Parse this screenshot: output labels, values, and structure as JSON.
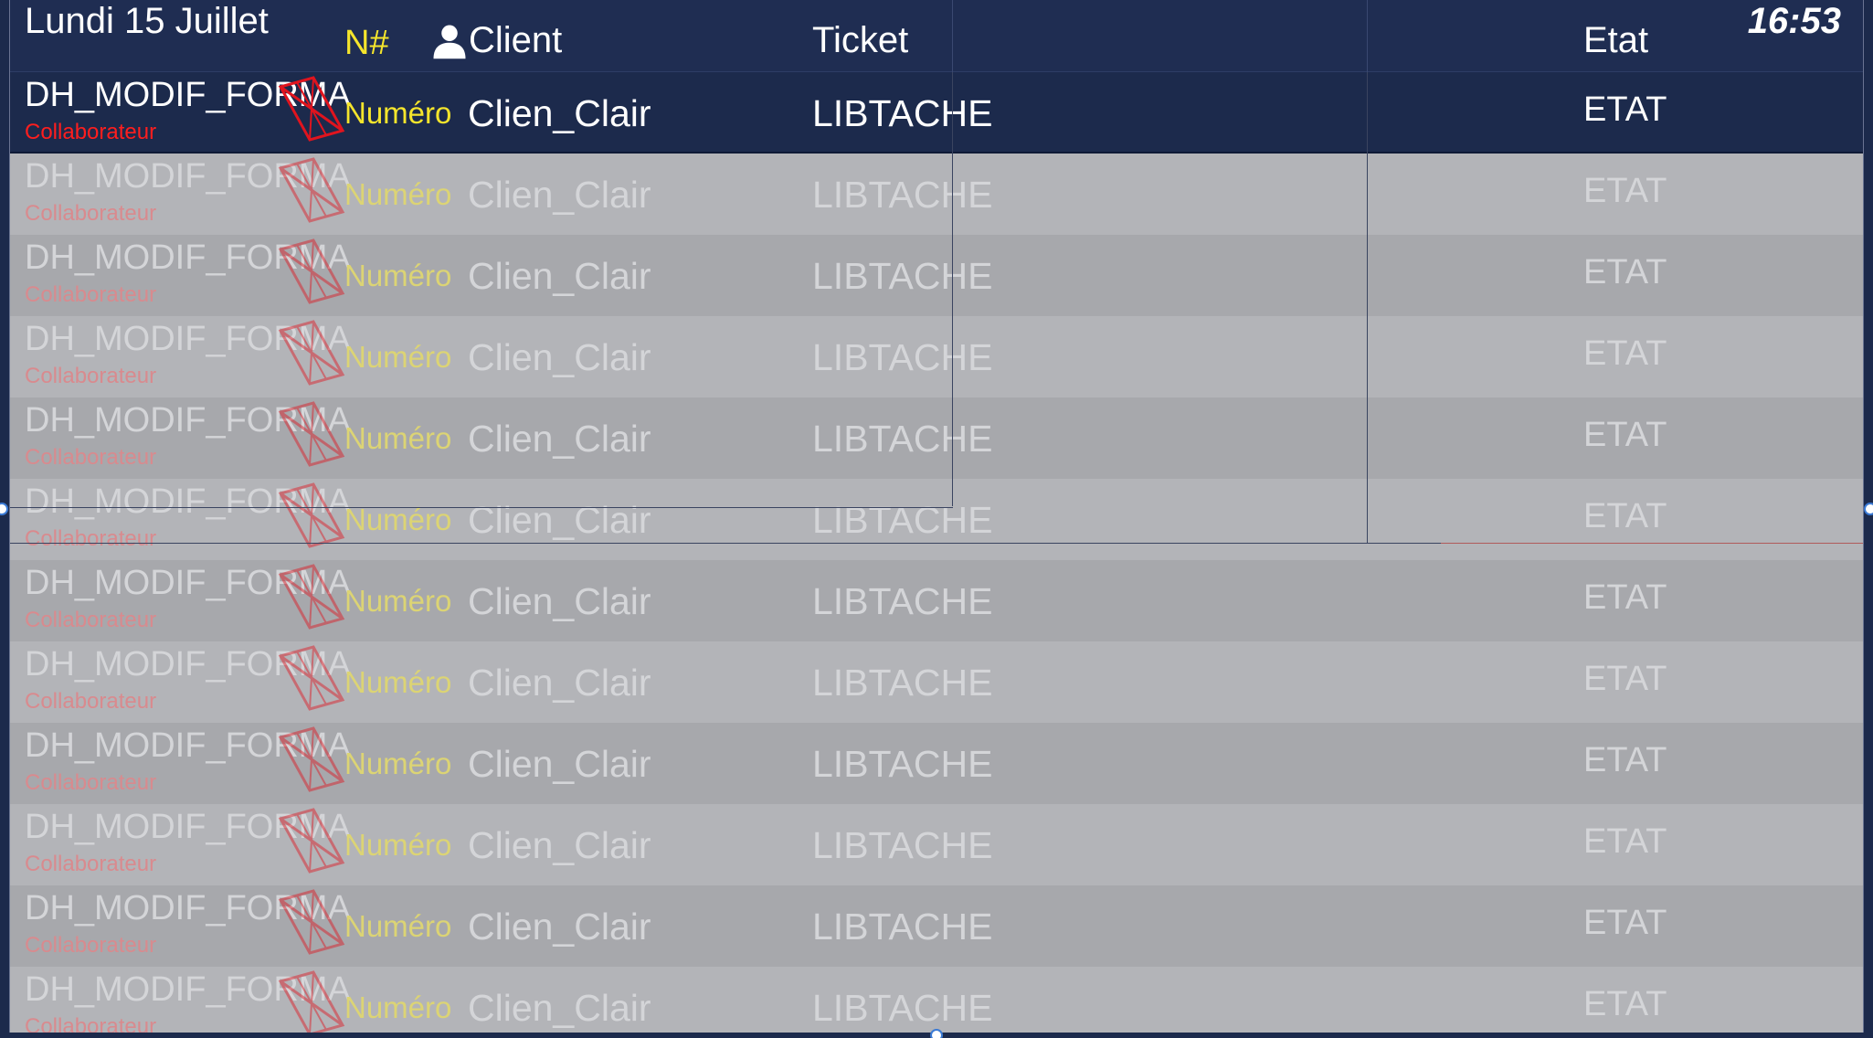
{
  "header": {
    "date": "Lundi 15 Juillet",
    "time": "16:53",
    "columns": {
      "number": "N#",
      "client": "Client",
      "ticket": "Ticket",
      "state": "Etat"
    }
  },
  "rows": [
    {
      "date_field": "DH_MODIF_FORMA",
      "collaborator": "Collaborateur",
      "number": "Numéro",
      "client": "Clien_Clair",
      "ticket": "LIBTACHE",
      "state": "ETAT",
      "highlighted": true
    },
    {
      "date_field": "DH_MODIF_FORMA",
      "collaborator": "Collaborateur",
      "number": "Numéro",
      "client": "Clien_Clair",
      "ticket": "LIBTACHE",
      "state": "ETAT"
    },
    {
      "date_field": "DH_MODIF_FORMA",
      "collaborator": "Collaborateur",
      "number": "Numéro",
      "client": "Clien_Clair",
      "ticket": "LIBTACHE",
      "state": "ETAT"
    },
    {
      "date_field": "DH_MODIF_FORMA",
      "collaborator": "Collaborateur",
      "number": "Numéro",
      "client": "Clien_Clair",
      "ticket": "LIBTACHE",
      "state": "ETAT"
    },
    {
      "date_field": "DH_MODIF_FORMA",
      "collaborator": "Collaborateur",
      "number": "Numéro",
      "client": "Clien_Clair",
      "ticket": "LIBTACHE",
      "state": "ETAT"
    },
    {
      "date_field": "DH_MODIF_FORMA",
      "collaborator": "Collaborateur",
      "number": "Numéro",
      "client": "Clien_Clair",
      "ticket": "LIBTACHE",
      "state": "ETAT"
    },
    {
      "date_field": "DH_MODIF_FORMA",
      "collaborator": "Collaborateur",
      "number": "Numéro",
      "client": "Clien_Clair",
      "ticket": "LIBTACHE",
      "state": "ETAT"
    },
    {
      "date_field": "DH_MODIF_FORMA",
      "collaborator": "Collaborateur",
      "number": "Numéro",
      "client": "Clien_Clair",
      "ticket": "LIBTACHE",
      "state": "ETAT"
    },
    {
      "date_field": "DH_MODIF_FORMA",
      "collaborator": "Collaborateur",
      "number": "Numéro",
      "client": "Clien_Clair",
      "ticket": "LIBTACHE",
      "state": "ETAT"
    },
    {
      "date_field": "DH_MODIF_FORMA",
      "collaborator": "Collaborateur",
      "number": "Numéro",
      "client": "Clien_Clair",
      "ticket": "LIBTACHE",
      "state": "ETAT"
    },
    {
      "date_field": "DH_MODIF_FORMA",
      "collaborator": "Collaborateur",
      "number": "Numéro",
      "client": "Clien_Clair",
      "ticket": "LIBTACHE",
      "state": "ETAT"
    },
    {
      "date_field": "DH_MODIF_FORMA",
      "collaborator": "Collaborateur",
      "number": "Numéro",
      "client": "Clien_Clair",
      "ticket": "LIBTACHE",
      "state": "ETAT"
    }
  ],
  "icons": {
    "client_header": "user-icon",
    "row_type": "ticket-type-icon"
  },
  "colors": {
    "header_bg": "#1f2d52",
    "highlight_bg": "#1c2a4c",
    "number_text": "#f5e52c",
    "collaborator_text": "#ff1e1e"
  }
}
